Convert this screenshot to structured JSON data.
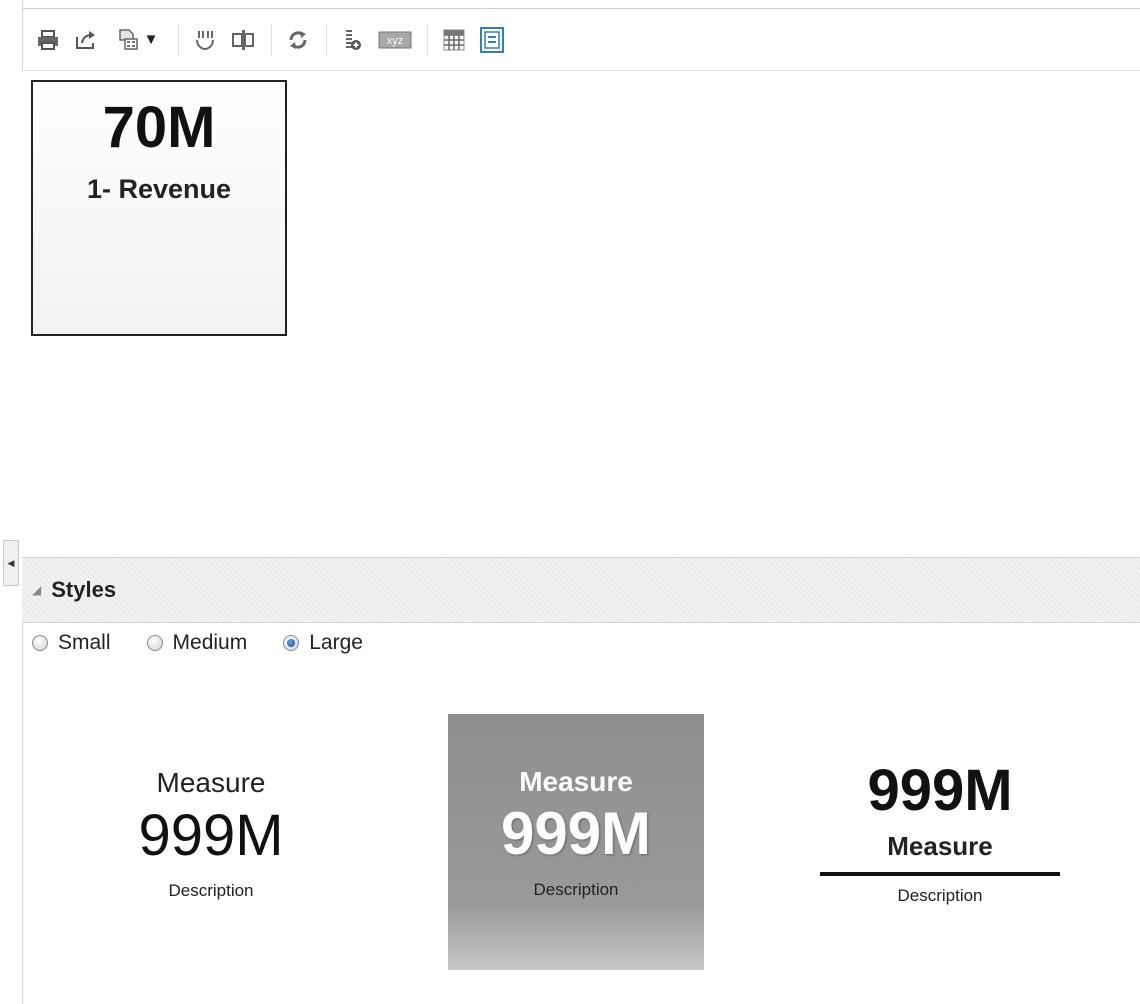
{
  "toolbar": {
    "icons": [
      "print-icon",
      "export-icon",
      "format-icon",
      "swap-icon",
      "split-icon",
      "refresh-icon",
      "add-calculation-icon",
      "xyz-icon",
      "grid-icon",
      "tile-view-icon"
    ],
    "active_color": "#2f7fc1"
  },
  "tile": {
    "value": "70M",
    "label": "1- Revenue"
  },
  "styles": {
    "title": "Styles",
    "options": [
      "Small",
      "Medium",
      "Large"
    ],
    "selected": "Large"
  },
  "previews": [
    {
      "measure": "Measure",
      "value": "999M",
      "description": "Description"
    },
    {
      "measure": "Measure",
      "value": "999M",
      "description": "Description"
    },
    {
      "value": "999M",
      "measure": "Measure",
      "description": "Description"
    }
  ]
}
